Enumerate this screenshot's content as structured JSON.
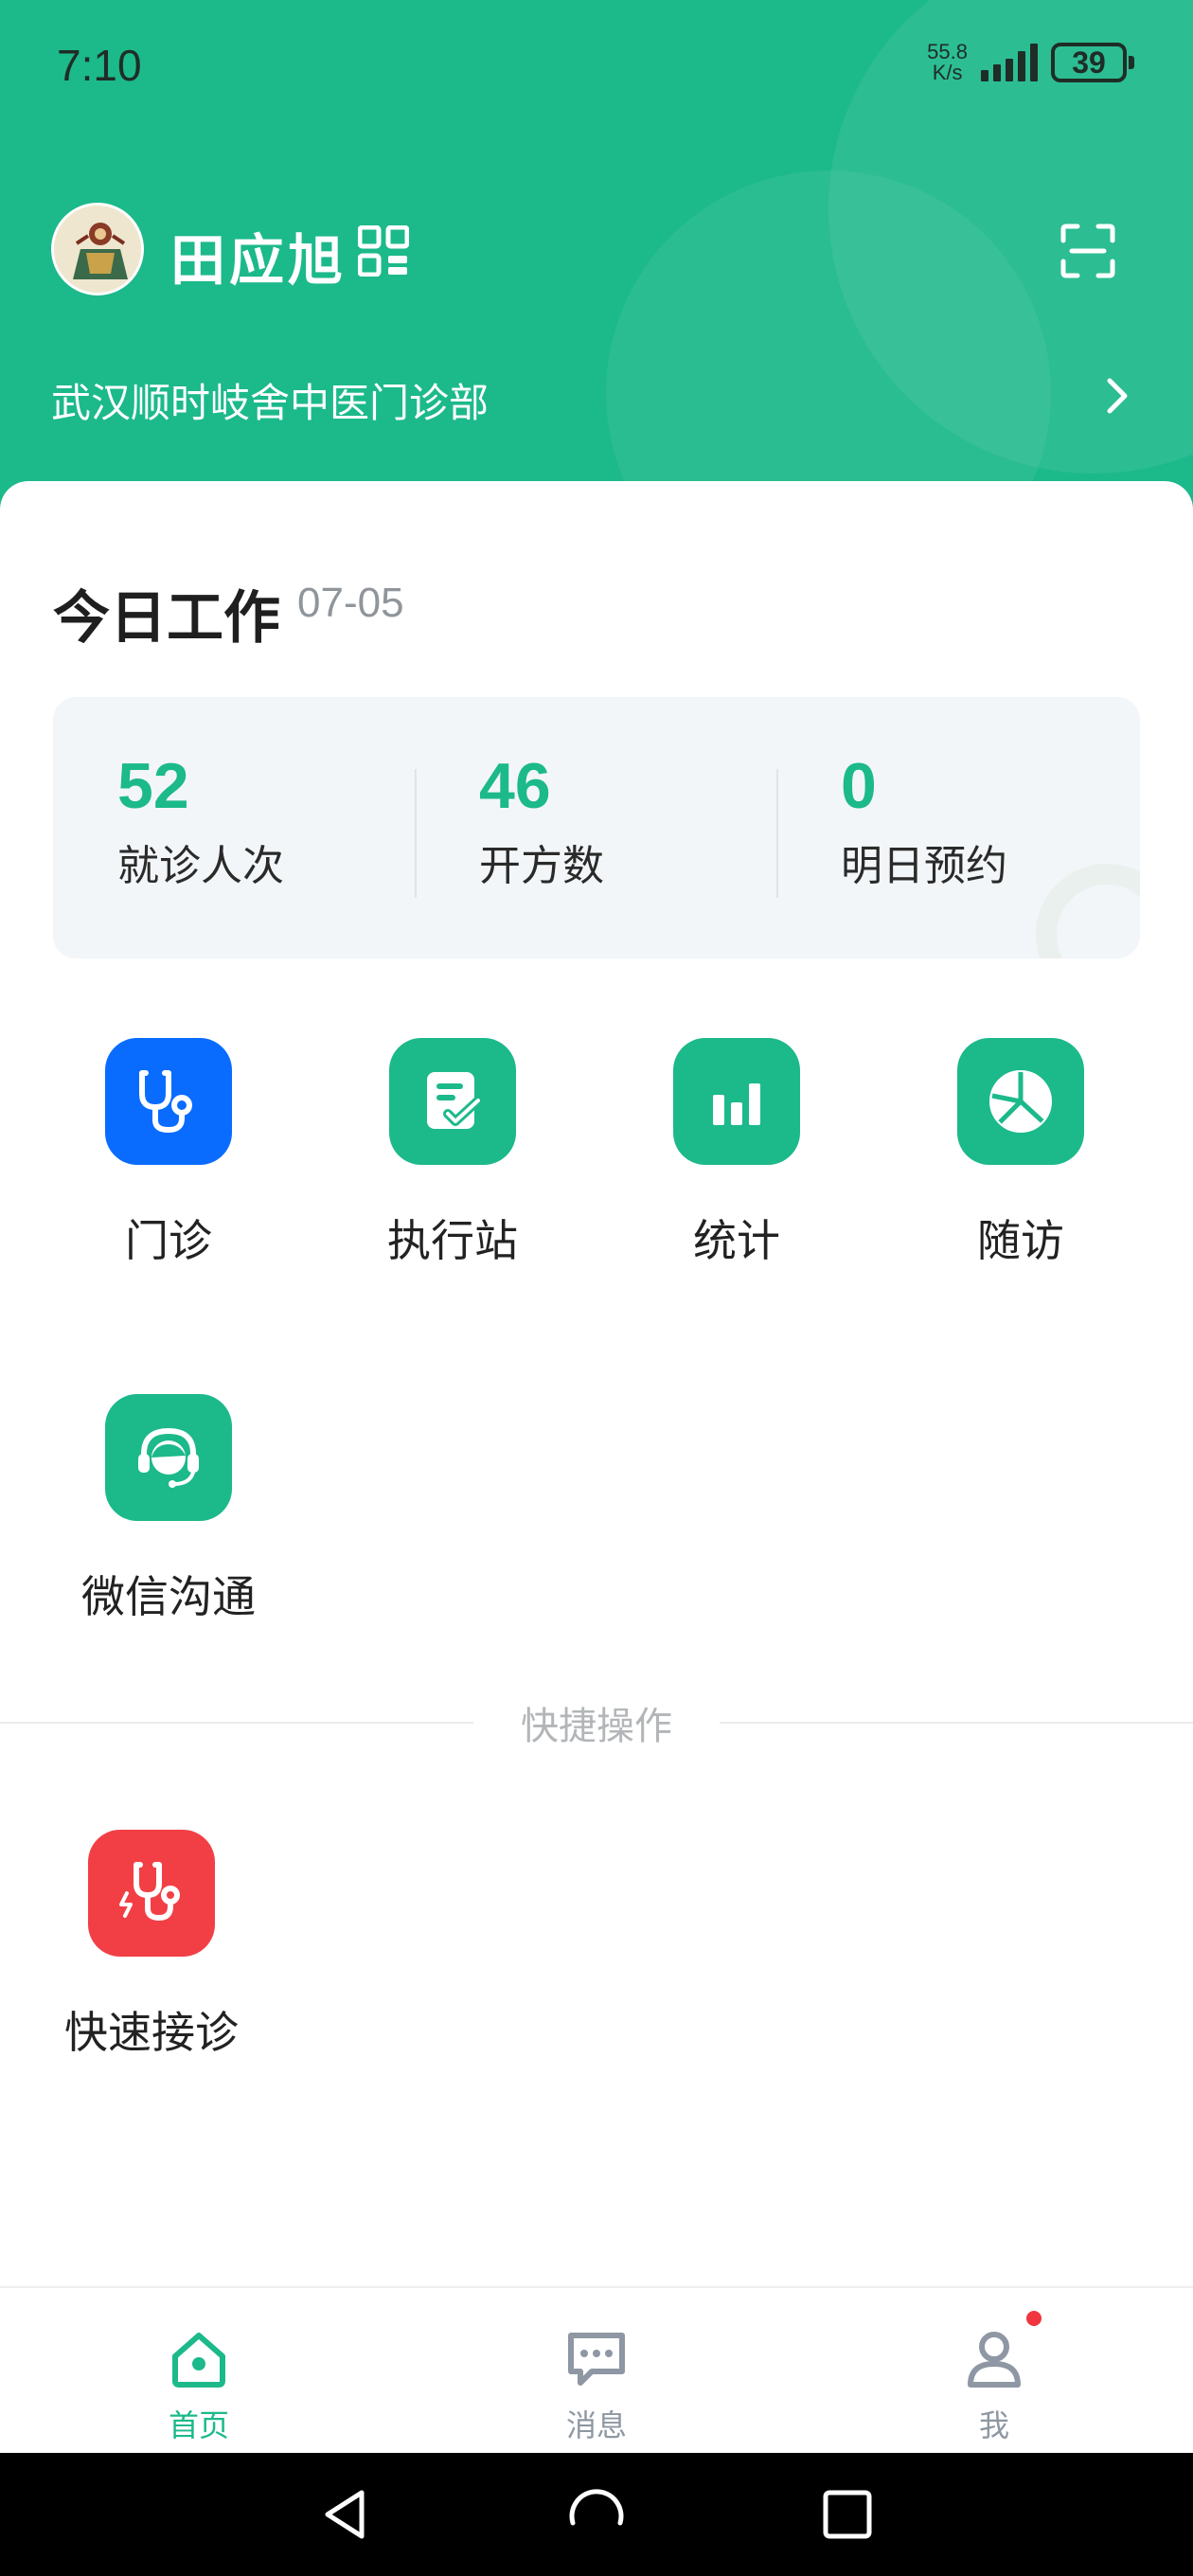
{
  "status_bar": {
    "time": "7:10",
    "net_speed_value": "55.8",
    "net_speed_unit": "K/s",
    "battery": "39"
  },
  "header": {
    "user_name": "田应旭",
    "clinic_name": "武汉顺时岐舍中医门诊部",
    "background_color": "#1cb98b"
  },
  "today": {
    "title": "今日工作",
    "date": "07-05",
    "stats": [
      {
        "value": "52",
        "label": "就诊人次"
      },
      {
        "value": "46",
        "label": "开方数"
      },
      {
        "value": "0",
        "label": "明日预约"
      }
    ]
  },
  "features": [
    {
      "label": "门诊",
      "icon": "stethoscope-icon",
      "color": "#0a6cff"
    },
    {
      "label": "执行站",
      "icon": "checklist-icon",
      "color": "#1cb98b"
    },
    {
      "label": "统计",
      "icon": "bar-chart-icon",
      "color": "#1cb98b"
    },
    {
      "label": "随访",
      "icon": "pie-clock-icon",
      "color": "#1cb98b"
    },
    {
      "label": "微信沟通",
      "icon": "headset-icon",
      "color": "#1cb98b"
    }
  ],
  "quick_actions": {
    "section_title": "快捷操作",
    "items": [
      {
        "label": "快速接诊",
        "icon": "quick-stethoscope-icon",
        "color": "#f23f45"
      }
    ]
  },
  "tabbar": {
    "tabs": [
      {
        "label": "首页",
        "icon": "home-icon",
        "active": true
      },
      {
        "label": "消息",
        "icon": "message-icon",
        "active": false
      },
      {
        "label": "我",
        "icon": "person-icon",
        "active": false
      }
    ],
    "active_color": "#1cb98b",
    "inactive_color": "#8e97a3"
  }
}
